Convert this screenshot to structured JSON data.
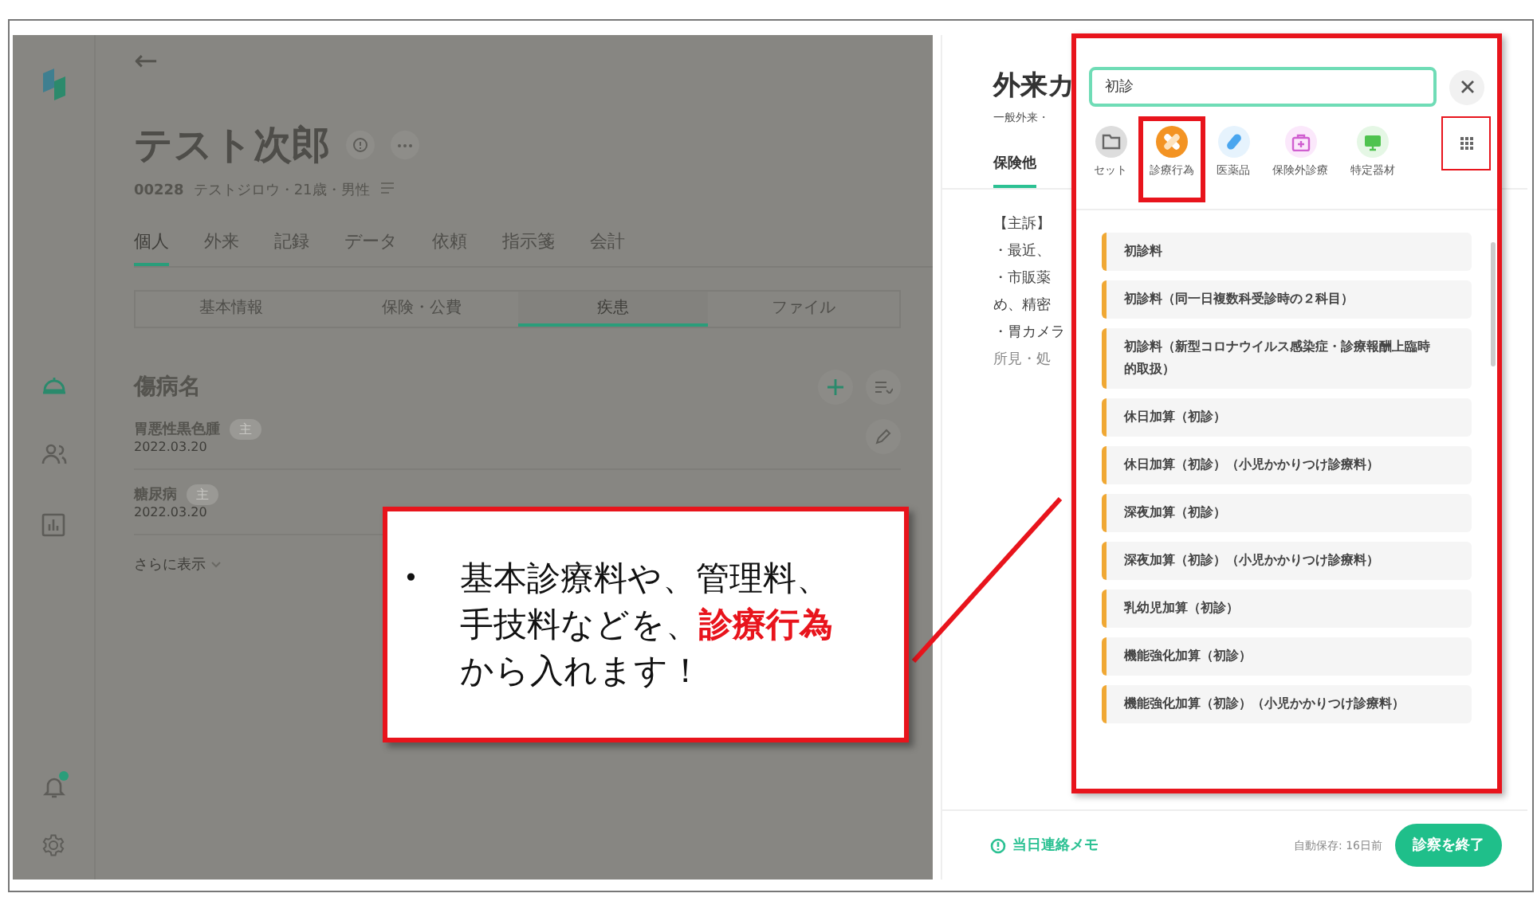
{
  "patient": {
    "back": "←",
    "name": "テスト次郎",
    "id": "00228",
    "details": "テストジロウ・21歳・男性"
  },
  "tabs": [
    {
      "label": "個人",
      "selected": true
    },
    {
      "label": "外来",
      "selected": false
    },
    {
      "label": "記録",
      "selected": false
    },
    {
      "label": "データ",
      "selected": false
    },
    {
      "label": "依頼",
      "selected": false
    },
    {
      "label": "指示箋",
      "selected": false
    },
    {
      "label": "会計",
      "selected": false
    }
  ],
  "subtabs": [
    {
      "label": "基本情報",
      "selected": false
    },
    {
      "label": "保険・公費",
      "selected": false
    },
    {
      "label": "疾患",
      "selected": true
    },
    {
      "label": "ファイル",
      "selected": false
    }
  ],
  "diseases": {
    "title": "傷病名",
    "rows": [
      {
        "name": "胃悪性黒色腫",
        "badge": "主",
        "date": "2022.03.20"
      },
      {
        "name": "糖尿病",
        "badge": "主",
        "date": "2022.03.20"
      }
    ],
    "more": "さらに表示"
  },
  "chart_panel": {
    "title": "外来カ",
    "subtitle": "一般外来・",
    "tab": "保険他",
    "lines": [
      "【主訴】",
      "・最近、",
      "・市販薬",
      "め、精密",
      "・胃カメラ",
      "所見・処"
    ]
  },
  "search": {
    "value": "初診"
  },
  "categories": [
    {
      "label": "セット",
      "kind": "folder",
      "selected": false
    },
    {
      "label": "診療行為",
      "kind": "procedure",
      "selected": true
    },
    {
      "label": "医薬品",
      "kind": "drug",
      "selected": false
    },
    {
      "label": "保険外診療",
      "kind": "private",
      "selected": false
    },
    {
      "label": "特定器材",
      "kind": "device",
      "selected": false
    }
  ],
  "results": [
    "初診料",
    "初診料（同一日複数科受診時の２科目）",
    "初診料（新型コロナウイルス感染症・診療報酬上臨時的取扱）",
    "休日加算（初診）",
    "休日加算（初診）（小児かかりつけ診療料）",
    "深夜加算（初診）",
    "深夜加算（初診）（小児かかりつけ診療料）",
    "乳幼児加算（初診）",
    "機能強化加算（初診）",
    "機能強化加算（初診）（小児かかりつけ診療料）"
  ],
  "footer": {
    "memo": "当日連絡メモ",
    "autosave": "自動保存: 16日前",
    "finish": "診察を終了"
  },
  "callout": {
    "bullet": "•",
    "text": "基本診療料や、管理料、手技料などを、**診療行為**から入れます！"
  }
}
